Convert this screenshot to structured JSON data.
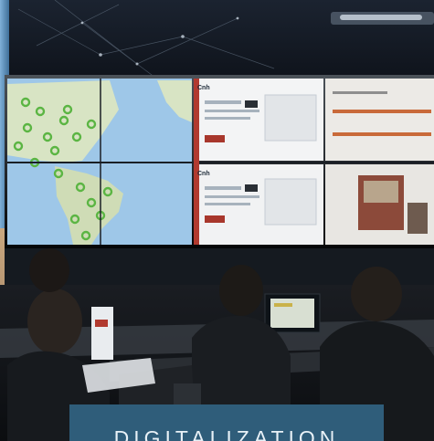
{
  "photo": {
    "subject": "control room",
    "screens": {
      "logo_text": "Cnh",
      "map_color": "#9ec7e8",
      "land_color": "#d8e4c4",
      "marker_color": "#5bb543"
    }
  },
  "banner": {
    "label": "DIGITALIZATION",
    "color": "#2f5d7a"
  }
}
